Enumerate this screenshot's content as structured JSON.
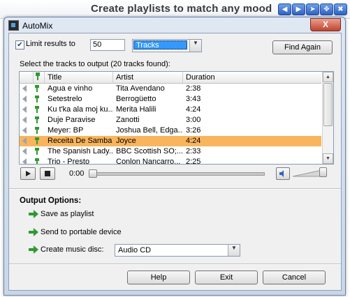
{
  "banner": {
    "title": "Create playlists to match any mood",
    "nav_icons": [
      "arrow-left-icon",
      "play-icon",
      "arrow-right-icon",
      "move-icon",
      "close-icon"
    ]
  },
  "window": {
    "title": "AutoMix",
    "close_label": "X"
  },
  "limit": {
    "checked": true,
    "label": "Limit results to",
    "value": "50",
    "unit_selected": "Tracks",
    "find_again_label": "Find Again"
  },
  "list_caption": "Select the tracks to output (20 tracks found):",
  "columns": {
    "title": "Title",
    "artist": "Artist",
    "duration": "Duration"
  },
  "tracks": [
    {
      "title": "Agua e vinho",
      "artist": "Tita Avendano",
      "duration": "2:38"
    },
    {
      "title": "Setestrelo",
      "artist": "Berrogüetto",
      "duration": "3:43"
    },
    {
      "title": "Ku t'ka ala moj ku...",
      "artist": "Merita Halili",
      "duration": "4:24"
    },
    {
      "title": "Duje Paravise",
      "artist": "Zanotti",
      "duration": "3:00"
    },
    {
      "title": "Meyer: BP",
      "artist": "Joshua Bell, Edga...",
      "duration": "3:26"
    },
    {
      "title": "Receita De Samba",
      "artist": "Joyce",
      "duration": "4:24",
      "selected": true
    },
    {
      "title": "The Spanish Lady...",
      "artist": "BBC Scottish SO;...",
      "duration": "2:33"
    },
    {
      "title": "Trio - Presto",
      "artist": "Conlon Nancarro...",
      "duration": "2:25"
    }
  ],
  "player": {
    "time": "0:00",
    "position": 0.0,
    "volume": 0.9
  },
  "output": {
    "heading": "Output Options:",
    "save_playlist": "Save as playlist",
    "send_device": "Send to portable device",
    "create_disc": "Create music disc:",
    "disc_type": "Audio CD"
  },
  "buttons": {
    "help": "Help",
    "exit": "Exit",
    "cancel": "Cancel"
  },
  "colors": {
    "selected_row": "#f8b55d",
    "accent_green": "#2e9a2e",
    "combo_highlight": "#3399ff"
  }
}
